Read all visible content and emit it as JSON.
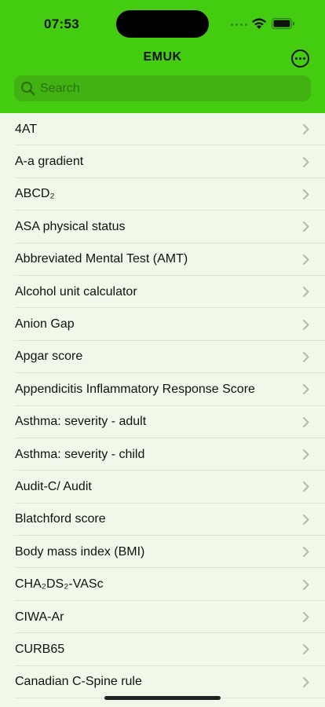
{
  "status_bar": {
    "time": "07:53"
  },
  "nav": {
    "title": "EMUK",
    "more_icon": "ellipsis-circle-icon"
  },
  "search": {
    "placeholder": "Search",
    "icon": "search-icon"
  },
  "list": {
    "items": [
      "4AT",
      "A-a gradient",
      "ABCD₂",
      "ASA physical status",
      "Abbreviated Mental Test (AMT)",
      "Alcohol unit calculator",
      "Anion Gap",
      "Apgar score",
      "Appendicitis Inflammatory Response Score",
      "Asthma: severity - adult",
      "Asthma: severity - child",
      "Audit-C/ Audit",
      "Blatchford score",
      "Body mass index (BMI)",
      "CHA₂DS₂-VASc",
      "CIWA-Ar",
      "CURB65",
      "Canadian C-Spine rule"
    ]
  },
  "colors": {
    "header": "#44cc11",
    "background": "#f0f9e9"
  }
}
